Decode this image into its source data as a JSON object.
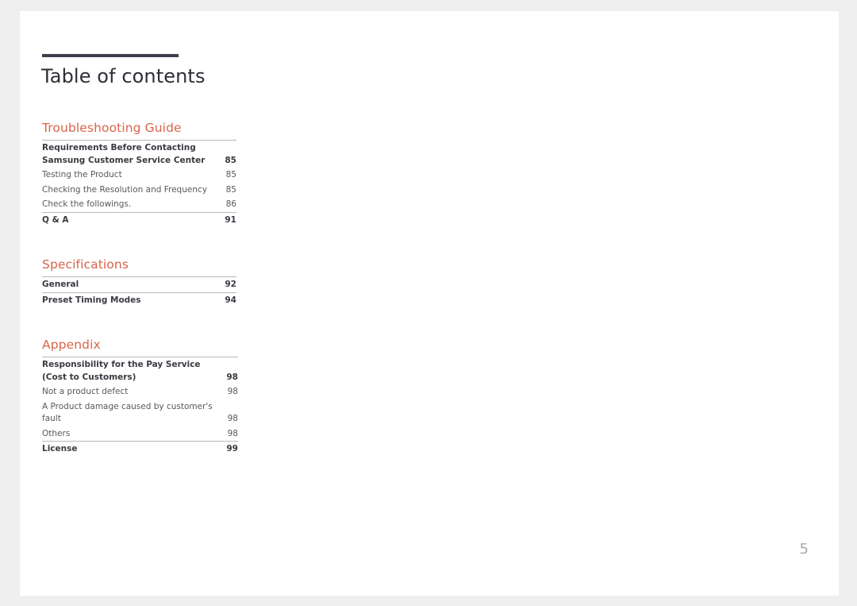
{
  "document": {
    "title": "Table of contents",
    "folio": "5",
    "accent_color": "#d9644a",
    "rule_color": "#3f3d4d"
  },
  "sections": [
    {
      "heading": "Troubleshooting Guide",
      "entries": [
        {
          "label": "Requirements Before Contacting Samsung Customer Service Center",
          "page": "85",
          "level": 1,
          "group_start": true
        },
        {
          "label": "Testing the Product",
          "page": "85",
          "level": 2,
          "group_start": false
        },
        {
          "label": "Checking the Resolution and Frequency",
          "page": "85",
          "level": 2,
          "group_start": false
        },
        {
          "label": "Check the followings.",
          "page": "86",
          "level": 2,
          "group_start": false
        },
        {
          "label": "Q & A",
          "page": "91",
          "level": 1,
          "group_start": true
        }
      ]
    },
    {
      "heading": "Specifications",
      "entries": [
        {
          "label": "General",
          "page": "92",
          "level": 1,
          "group_start": true
        },
        {
          "label": "Preset Timing Modes",
          "page": "94",
          "level": 1,
          "group_start": true
        }
      ]
    },
    {
      "heading": "Appendix",
      "entries": [
        {
          "label": "Responsibility for the Pay Service (Cost to Customers)",
          "page": "98",
          "level": 1,
          "group_start": true
        },
        {
          "label": "Not a product defect",
          "page": "98",
          "level": 2,
          "group_start": false
        },
        {
          "label": "A Product damage caused by customer's fault",
          "page": "98",
          "level": 2,
          "group_start": false
        },
        {
          "label": "Others",
          "page": "98",
          "level": 2,
          "group_start": false
        },
        {
          "label": "License",
          "page": "99",
          "level": 1,
          "group_start": true
        }
      ]
    }
  ]
}
